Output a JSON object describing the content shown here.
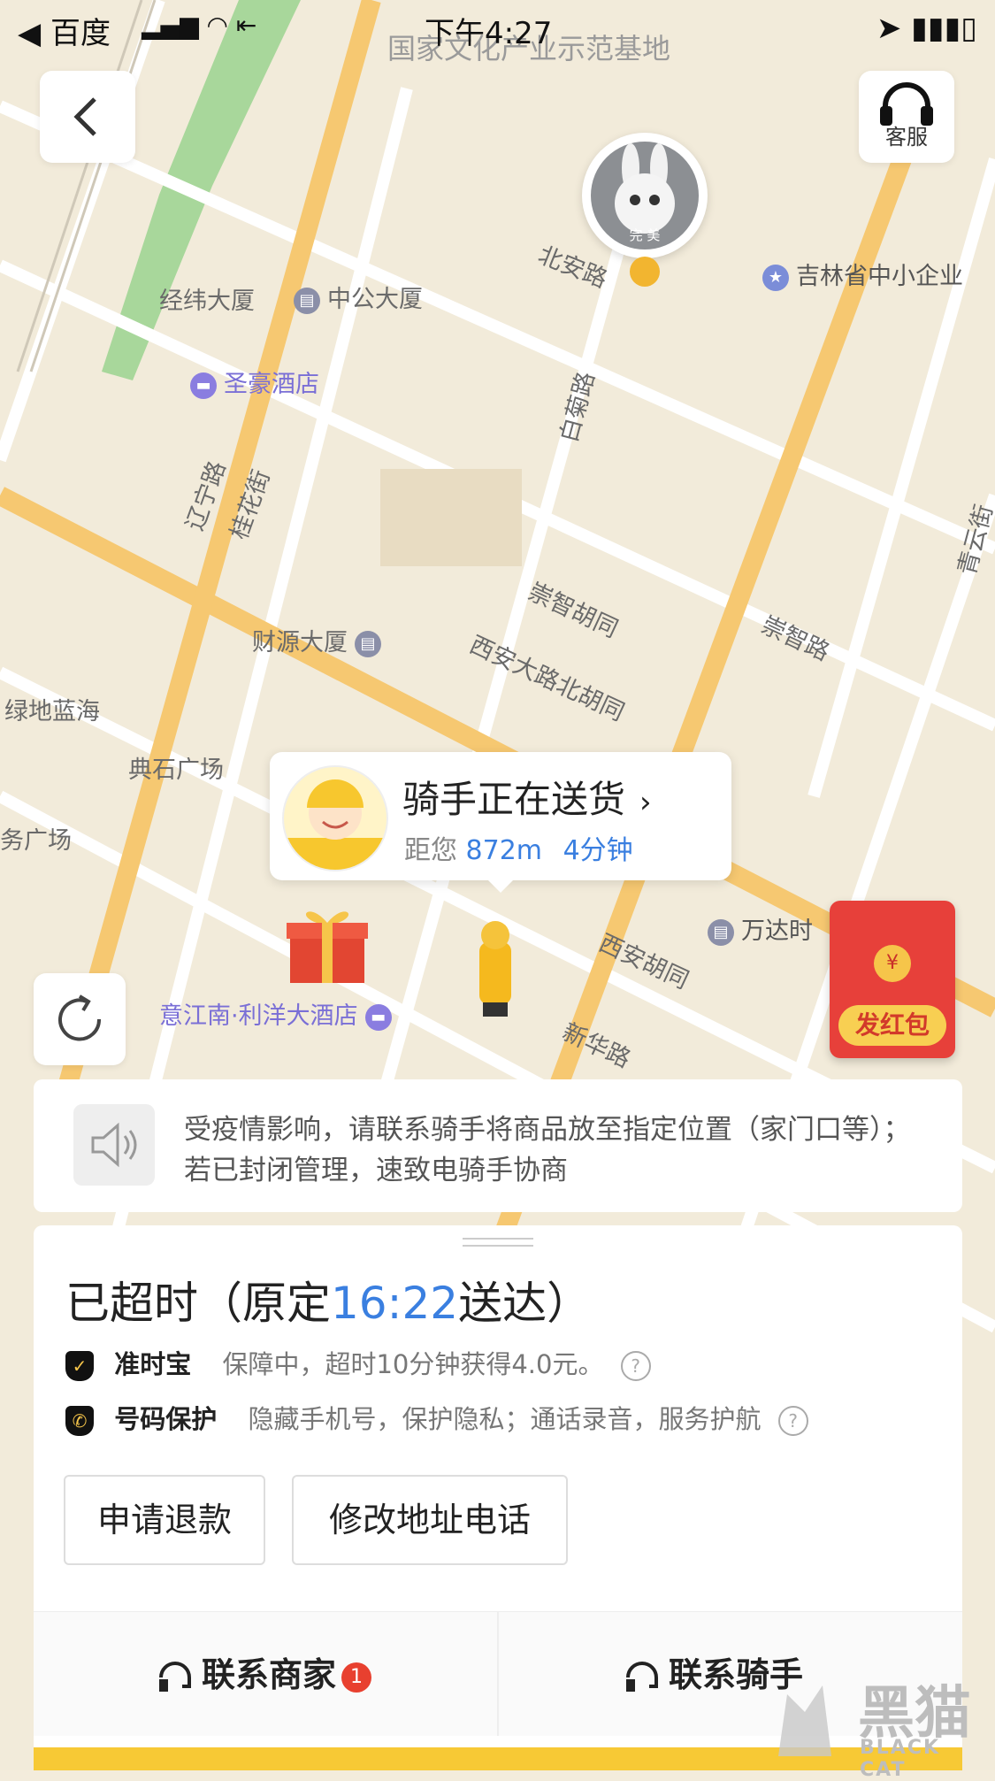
{
  "status_bar": {
    "back_app": "◀ 百度",
    "time": "下午4:27"
  },
  "header": {
    "service_label": "客服"
  },
  "map": {
    "labels": {
      "culture_base": "国家文化产业示范基地",
      "jingwei": "经纬大厦",
      "zhonggong": "中公大厦",
      "shenghao": "圣豪酒店",
      "beian": "北安路",
      "jilin": "吉林省中小企业",
      "baiju": "白菊路",
      "liaoning": "辽宁路",
      "guihua": "桂花街",
      "caiyuan": "财源大厦",
      "lvdi": "绿地蓝海",
      "dianshi": "典石广场",
      "chongzhi": "崇智胡同",
      "chongzhi_road": "崇智路",
      "xian_north": "西安大路北胡同",
      "xian_hutong": "西安胡同",
      "xinhua": "新华路",
      "wanda": "万达时",
      "yijiangnan": "意江南·利洋大酒店",
      "wuguangchang": "务广场",
      "qingyun": "青云街",
      "avatar_tag": "完 美"
    }
  },
  "rider_card": {
    "title": "骑手正在送货",
    "distance_prefix": "距您",
    "distance": "872m",
    "eta": "4分钟"
  },
  "red_packet": {
    "label": "发红包",
    "coin": "¥"
  },
  "notice": {
    "text": "受疫情影响，请联系骑手将商品放至指定位置（家门口等）；若已封闭管理，速致电骑手协商"
  },
  "panel": {
    "status_prefix": "已超时（原定",
    "status_time": "16:22",
    "status_suffix": "送达）",
    "ontime": {
      "name": "准时宝",
      "desc": "保障中，超时10分钟获得4.0元。"
    },
    "privacy": {
      "name": "号码保护",
      "desc": "隐藏手机号，保护隐私；通话录音，服务护航"
    },
    "buttons": {
      "refund": "申请退款",
      "modify": "修改地址电话"
    },
    "contact": {
      "merchant": "联系商家",
      "merchant_badge": "1",
      "rider": "联系骑手"
    }
  },
  "watermark": {
    "cn": "黑猫",
    "en": "BLACK CAT"
  },
  "colors": {
    "accent_blue": "#3a7fe0",
    "red": "#e7403a",
    "yellow": "#f7c935"
  }
}
